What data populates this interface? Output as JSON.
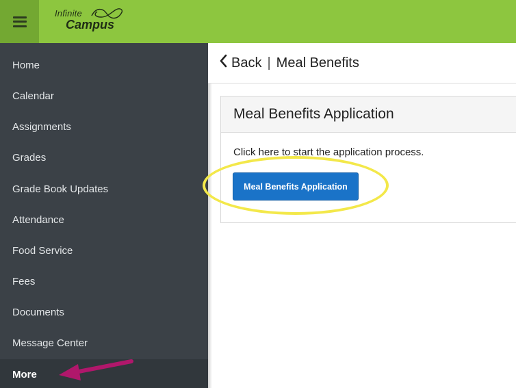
{
  "colors": {
    "topbar": "#8dc63f",
    "menu_button": "#73a832",
    "sidebar": "#3b4147",
    "sidebar_active": "#31373c",
    "primary_button": "#1a73c8",
    "highlight_ellipse": "#f3e84a",
    "annotation_arrow": "#b0176b"
  },
  "topbar": {
    "menu_icon": "hamburger-icon",
    "logo": {
      "line1": "Infinite",
      "line2": "Campus"
    }
  },
  "sidebar": {
    "items": [
      {
        "label": "Home"
      },
      {
        "label": "Calendar"
      },
      {
        "label": "Assignments"
      },
      {
        "label": "Grades"
      },
      {
        "label": "Grade Book Updates"
      },
      {
        "label": "Attendance"
      },
      {
        "label": "Food Service"
      },
      {
        "label": "Fees"
      },
      {
        "label": "Documents"
      },
      {
        "label": "Message Center"
      },
      {
        "label": "More",
        "active": true
      }
    ]
  },
  "header": {
    "back_icon": "chevron-left-icon",
    "back_label": "Back",
    "separator": "|",
    "title": "Meal Benefits"
  },
  "card": {
    "title": "Meal Benefits Application",
    "instructions": "Click here to start the application process.",
    "button_label": "Meal Benefits Application"
  }
}
